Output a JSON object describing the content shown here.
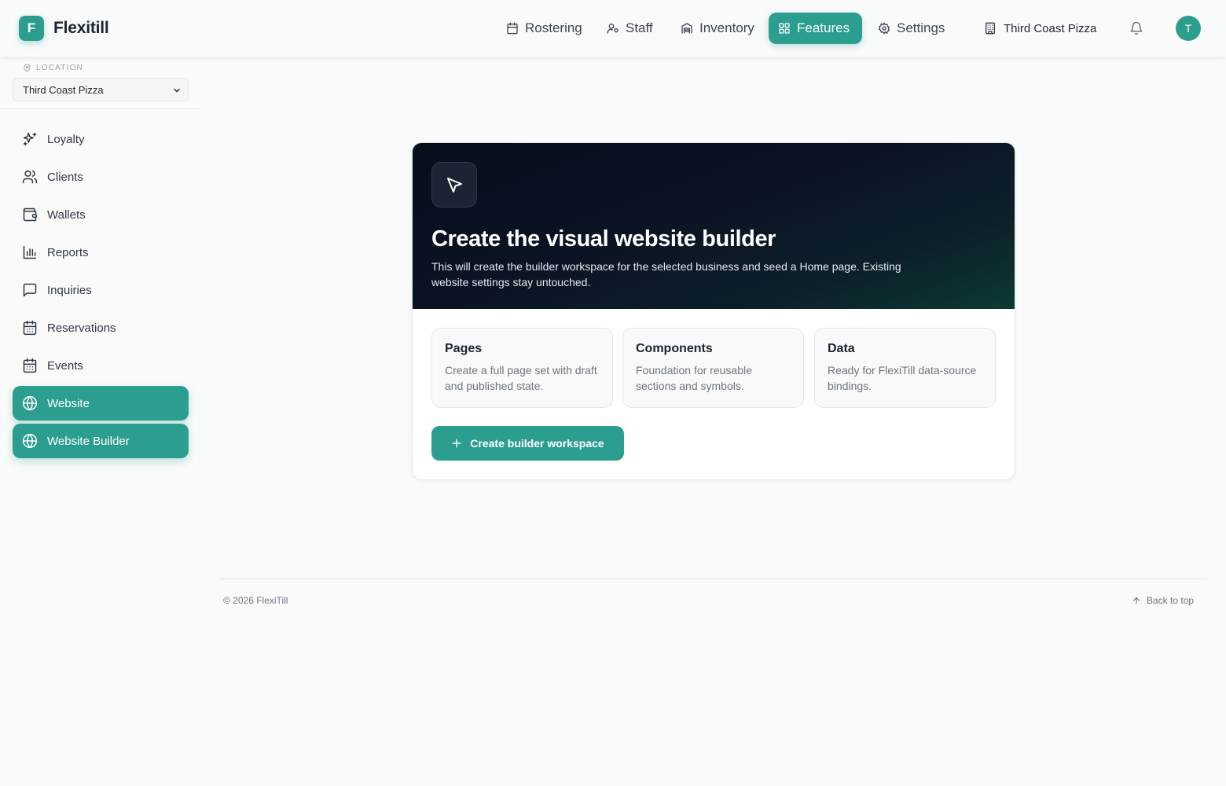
{
  "header": {
    "logo_letter": "F",
    "app_name": "Flexitill",
    "nav": [
      {
        "label": "Rostering",
        "icon": "calendar-icon"
      },
      {
        "label": "Staff",
        "icon": "user-cog-icon"
      },
      {
        "label": "Inventory",
        "icon": "warehouse-icon"
      },
      {
        "label": "Features",
        "icon": "grid-icon",
        "active": true
      },
      {
        "label": "Settings",
        "icon": "gear-icon"
      }
    ],
    "business_name": "Third Coast Pizza",
    "avatar_initial": "T",
    "accent_color": "#2b9e8f"
  },
  "sidebar": {
    "location_label": "LOCATION",
    "location_value": "Third Coast Pizza",
    "items": [
      {
        "label": "Loyalty",
        "icon": "sparkles-icon"
      },
      {
        "label": "Clients",
        "icon": "users-icon"
      },
      {
        "label": "Wallets",
        "icon": "wallet-icon"
      },
      {
        "label": "Reports",
        "icon": "bar-chart-icon"
      },
      {
        "label": "Inquiries",
        "icon": "message-square-icon"
      },
      {
        "label": "Reservations",
        "icon": "calendar-icon"
      },
      {
        "label": "Events",
        "icon": "calendar-icon"
      },
      {
        "label": "Website",
        "icon": "globe-icon",
        "active": true
      },
      {
        "label": "Website Builder",
        "icon": "globe-icon",
        "active": true
      }
    ]
  },
  "main": {
    "hero": {
      "icon": "cursor-pointer-icon",
      "title": "Create the visual website builder",
      "description": "This will create the builder workspace for the selected business and seed a Home page. Existing website settings stay untouched."
    },
    "tiles": [
      {
        "title": "Pages",
        "description": "Create a full page set with draft and published state."
      },
      {
        "title": "Components",
        "description": "Foundation for reusable sections and symbols."
      },
      {
        "title": "Data",
        "description": "Ready for FlexiTill data-source bindings."
      }
    ],
    "create_button": {
      "label": "Create builder workspace",
      "icon": "plus-icon"
    }
  },
  "footer": {
    "copyright": "© 2026 FlexiTill",
    "back_to_top": "Back to top"
  }
}
